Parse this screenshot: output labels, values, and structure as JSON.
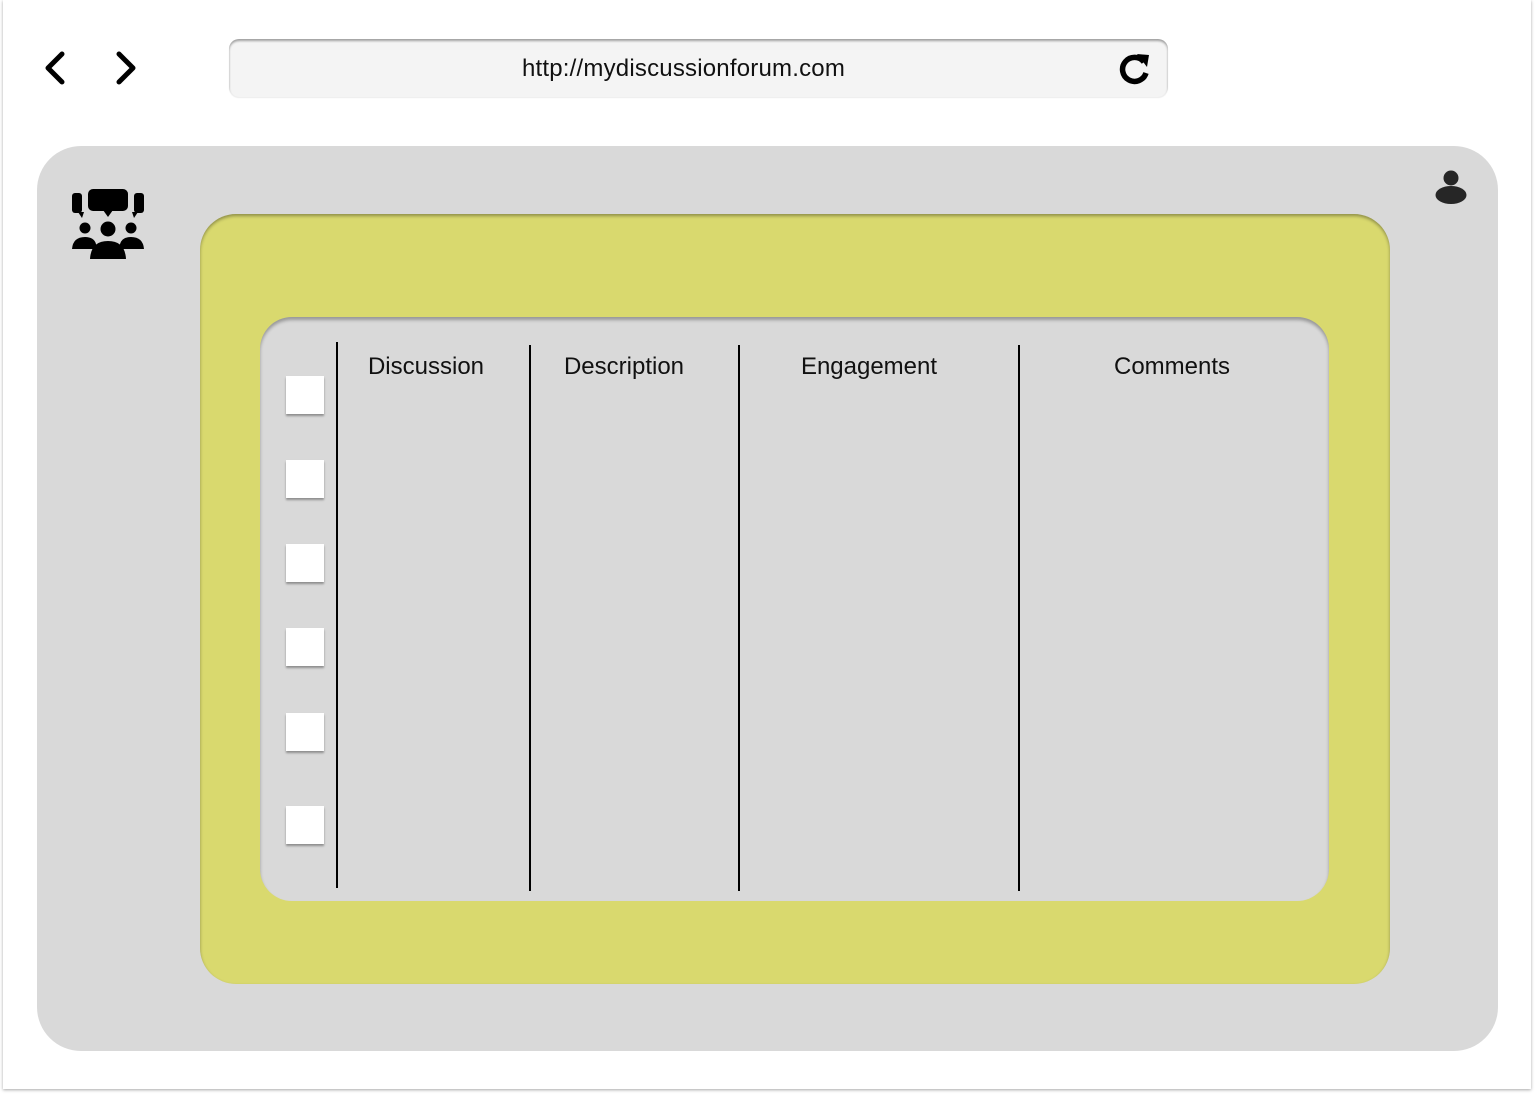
{
  "browser": {
    "url": "http://mydiscussionforum.com",
    "icons": {
      "back": "chevron-left-icon",
      "forward": "chevron-right-icon",
      "reload": "reload-icon"
    }
  },
  "app": {
    "logo_icon": "discussion-group-icon",
    "profile_icon": "user-icon",
    "colors": {
      "panel": "#d9d9d9",
      "card": "#d9d96e",
      "checkbox": "#ffffff"
    }
  },
  "table": {
    "columns": [
      {
        "label": "Discussion"
      },
      {
        "label": "Description"
      },
      {
        "label": "Engagement"
      },
      {
        "label": "Comments"
      }
    ],
    "rows": [
      {
        "checked": false
      },
      {
        "checked": false
      },
      {
        "checked": false
      },
      {
        "checked": false
      },
      {
        "checked": false
      },
      {
        "checked": false
      }
    ]
  }
}
